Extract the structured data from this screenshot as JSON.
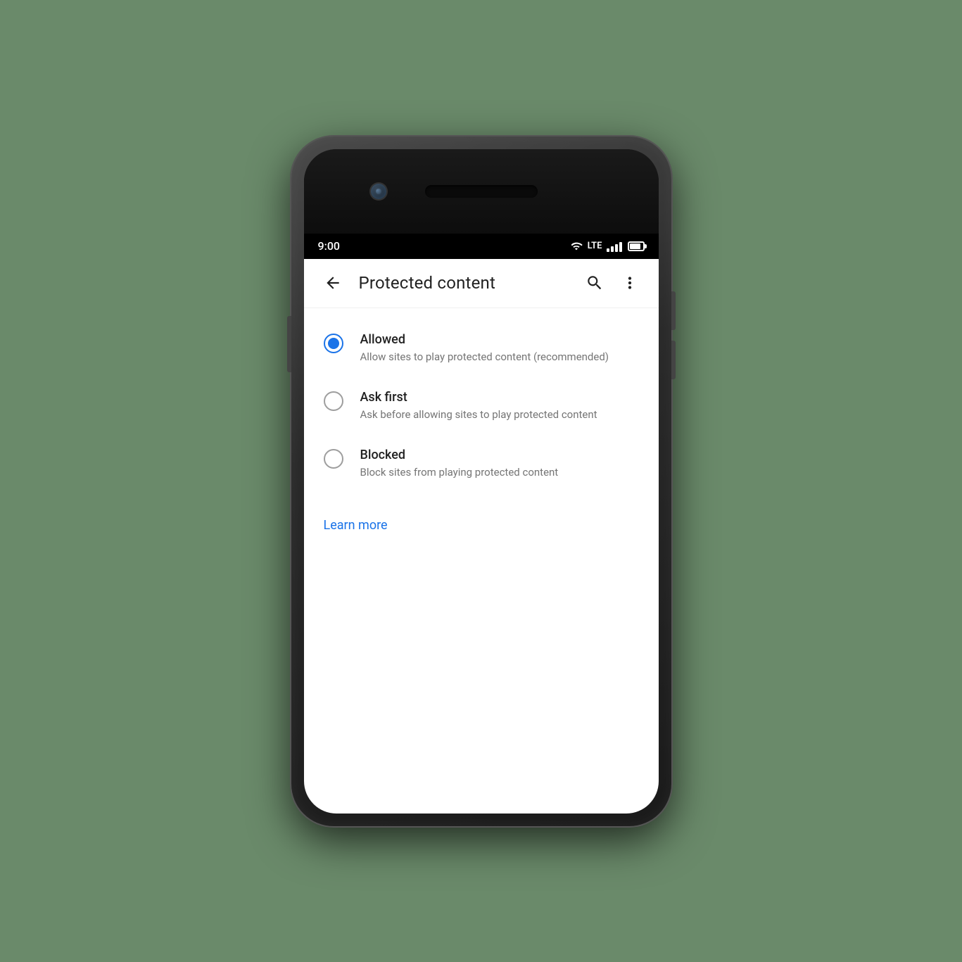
{
  "status_bar": {
    "time": "9:00",
    "lte_label": "LTE"
  },
  "app_bar": {
    "title": "Protected content",
    "back_label": "back",
    "search_label": "search",
    "more_label": "more options"
  },
  "options": [
    {
      "id": "allowed",
      "title": "Allowed",
      "description": "Allow sites to play protected content (recommended)",
      "selected": true
    },
    {
      "id": "ask_first",
      "title": "Ask first",
      "description": "Ask before allowing sites to play protected content",
      "selected": false
    },
    {
      "id": "blocked",
      "title": "Blocked",
      "description": "Block sites from playing protected content",
      "selected": false
    }
  ],
  "learn_more": {
    "label": "Learn more"
  }
}
